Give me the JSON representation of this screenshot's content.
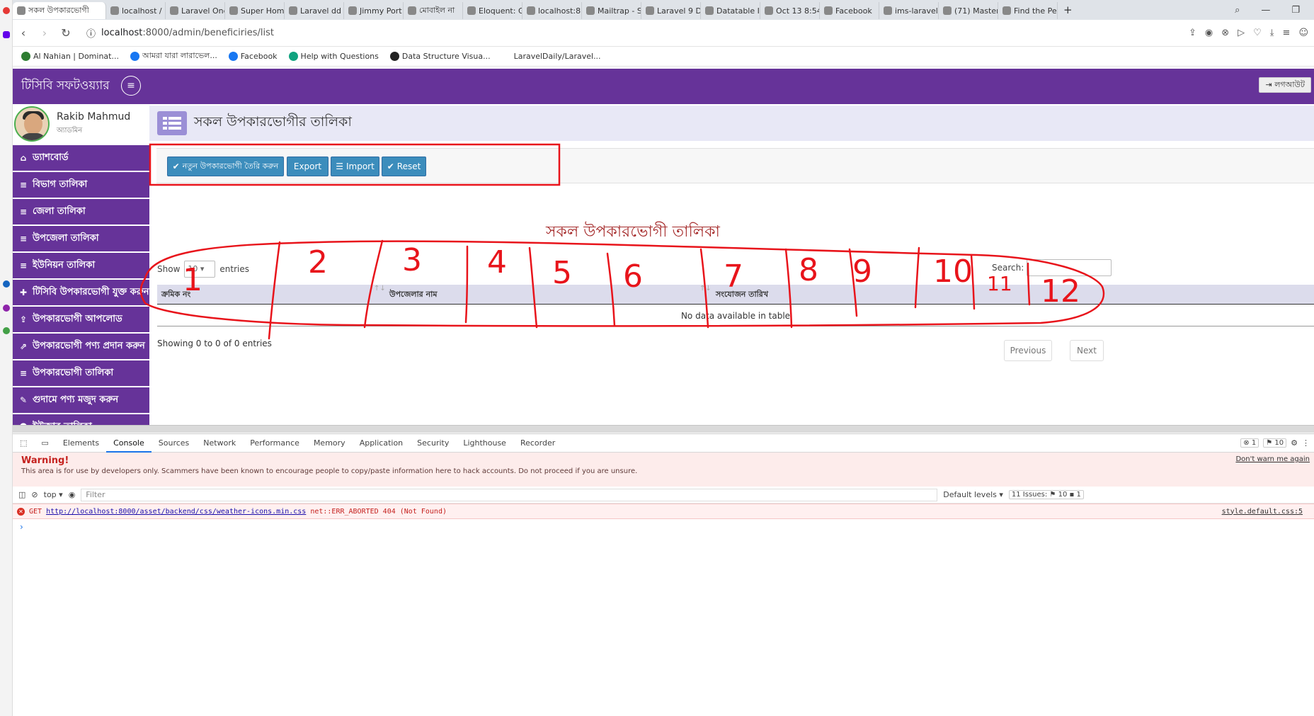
{
  "browser": {
    "tabs": [
      {
        "title": "সকল উপকারভোগী",
        "active": true
      },
      {
        "title": "localhost /"
      },
      {
        "title": "Laravel One"
      },
      {
        "title": "Super Hom"
      },
      {
        "title": "Laravel dd"
      },
      {
        "title": "Jimmy Port"
      },
      {
        "title": "মোবাইল না"
      },
      {
        "title": "Eloquent: G"
      },
      {
        "title": "localhost:8"
      },
      {
        "title": "Mailtrap - S"
      },
      {
        "title": "Laravel 9 D"
      },
      {
        "title": "Datatable I"
      },
      {
        "title": "Oct 13 8:54"
      },
      {
        "title": "Facebook"
      },
      {
        "title": "ims-laravel"
      },
      {
        "title": "(71) Master"
      },
      {
        "title": "Find the Pe"
      }
    ],
    "new_tab": "+",
    "url_host": "localhost",
    "url_path": ":8000/admin/beneficiries/list",
    "bookmarks": [
      {
        "label": "Al Nahian | Dominat...",
        "color": "#2e7d32"
      },
      {
        "label": "আমরা যারা লারাভেল...",
        "color": "#1877f2"
      },
      {
        "label": "Facebook",
        "color": "#1877f2"
      },
      {
        "label": "Help with Questions",
        "color": "#10a37f"
      },
      {
        "label": "Data Structure Visua...",
        "color": "#222222"
      },
      {
        "label": "LaravelDaily/Laravel...",
        "color": "#ffffff"
      }
    ]
  },
  "app": {
    "brand": "টিসিবি সফটওয়্যার",
    "logout": "লগআউট",
    "user": {
      "name": "Rakib Mahmud",
      "role": "অ্যাডমিন"
    },
    "menu": [
      {
        "label": "ড্যাশবোর্ড",
        "icon": "home-icon"
      },
      {
        "label": "বিভাগ তালিকা",
        "icon": "list-icon"
      },
      {
        "label": "জেলা তালিকা",
        "icon": "list-icon"
      },
      {
        "label": "উপজেলা তালিকা",
        "icon": "list-icon"
      },
      {
        "label": "ইউনিয়ন তালিকা",
        "icon": "list-icon"
      },
      {
        "label": "টিসিবি উপকারভোগী যুক্ত করুন",
        "icon": "plus-icon"
      },
      {
        "label": "উপকারভোগী আপলোড",
        "icon": "upload-icon"
      },
      {
        "label": "উপকারভোগী পণ্য প্রদান করুন",
        "icon": "share-icon"
      },
      {
        "label": "উপকারভোগী তালিকা",
        "icon": "list-icon"
      },
      {
        "label": "গুদামে পণ্য মজুদ করুন",
        "icon": "pencil-icon"
      },
      {
        "label": "ইউজার তালিকা",
        "icon": "users-icon"
      }
    ],
    "page_title": "সকল উপকারভোগীর তালিকা",
    "buttons": {
      "create": "নতুন উপকারভোগী তৈরি করুন",
      "export": "Export",
      "import": "Import",
      "reset": "Reset"
    },
    "table": {
      "title": "সকল উপকারভোগী তালিকা",
      "show_label": "Show",
      "show_value": "10",
      "entries_label": "entries",
      "search_label": "Search:",
      "columns": [
        "ক্রমিক নং",
        "উপজেলার নাম",
        "সংযোজন তারিখ"
      ],
      "empty": "No data available in table",
      "info": "Showing 0 to 0 of 0 entries",
      "prev": "Previous",
      "next": "Next"
    }
  },
  "devtools": {
    "tabs": [
      "Elements",
      "Console",
      "Sources",
      "Network",
      "Performance",
      "Memory",
      "Application",
      "Security",
      "Lighthouse",
      "Recorder"
    ],
    "active_tab": "Console",
    "error_count": "1",
    "warning_count": "10",
    "warning_title": "Warning!",
    "warning_text": "This area is for use by developers only. Scammers have been known to encourage people to copy/paste information here to hack accounts. Do not proceed if you are unsure.",
    "dont_warn": "Don't warn me again",
    "context": "top",
    "filter_placeholder": "Filter",
    "levels": "Default levels",
    "issues": "11 Issues:",
    "issues_errors": "10",
    "issues_info": "1",
    "error": {
      "method": "GET",
      "url": "http://localhost:8000/asset/backend/css/weather-icons.min.css",
      "message": "net::ERR_ABORTED 404 (Not Found)",
      "source": "style.default.css:5"
    },
    "prompt": "›"
  },
  "annotations": {
    "numbers": [
      "1",
      "2",
      "3",
      "4",
      "5",
      "6",
      "7",
      "8",
      "9",
      "10",
      "11",
      "12"
    ],
    "color": "#e8141b"
  }
}
